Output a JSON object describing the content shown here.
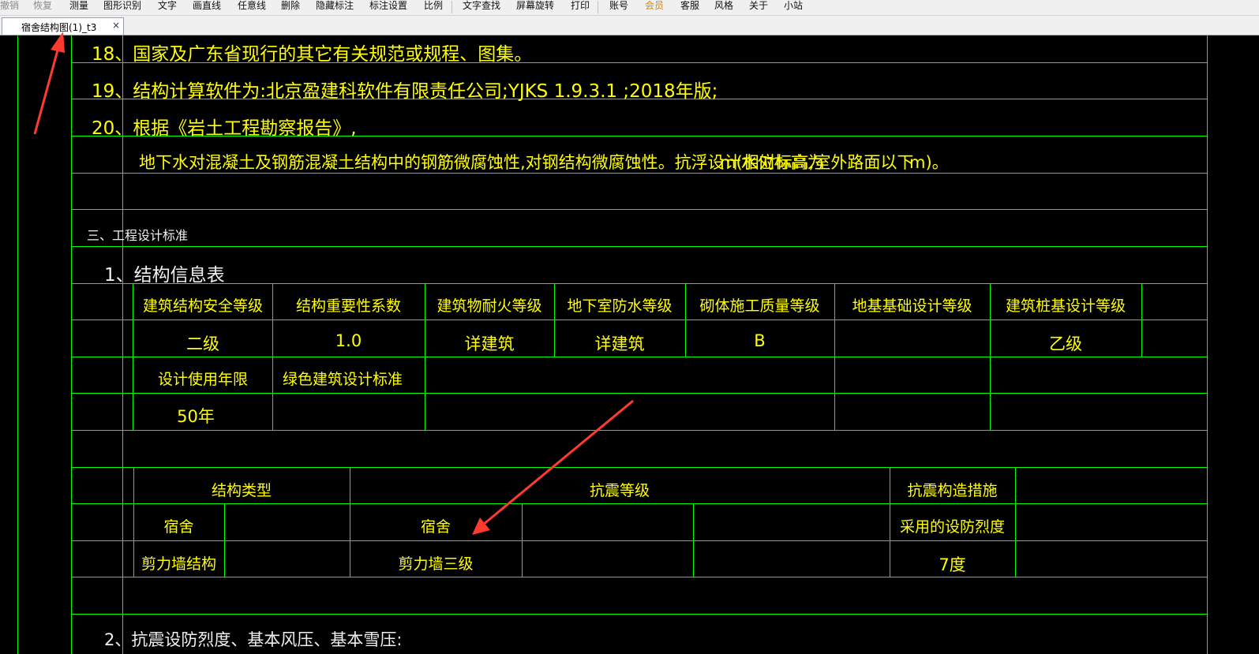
{
  "menu": [
    {
      "label": "撤销",
      "state": "disabled"
    },
    {
      "label": "恢复",
      "state": "disabled"
    },
    {
      "label": "测量",
      "state": "normal"
    },
    {
      "label": "图形识别",
      "state": "normal"
    },
    {
      "label": "文字",
      "state": "normal"
    },
    {
      "label": "画直线",
      "state": "normal"
    },
    {
      "label": "任意线",
      "state": "normal"
    },
    {
      "label": "删除",
      "state": "normal"
    },
    {
      "label": "隐藏标注",
      "state": "normal"
    },
    {
      "label": "标注设置",
      "state": "normal"
    },
    {
      "label": "比例",
      "state": "normal"
    },
    {
      "label": "文字查找",
      "state": "normal"
    },
    {
      "label": "屏幕旋转",
      "state": "normal"
    },
    {
      "label": "打印",
      "state": "normal"
    },
    {
      "label": "账号",
      "state": "normal"
    },
    {
      "label": "会员",
      "state": "vip"
    },
    {
      "label": "客服",
      "state": "normal"
    },
    {
      "label": "风格",
      "state": "normal"
    },
    {
      "label": "关于",
      "state": "normal"
    },
    {
      "label": "小站",
      "state": "normal"
    }
  ],
  "tab": {
    "label": "宿舍结构图(1)_t3",
    "close": "×"
  },
  "colors": {
    "cad_text": "#ffff00",
    "cad_lines": "#00ff00",
    "cad_heading": "#f0f0f0",
    "background": "#000000",
    "annotation_arrow": "#ff3b30",
    "vip_menu": "#d08a00"
  },
  "notes": {
    "n18": "18、国家及广东省现行的其它有关规范或规程、图集。",
    "n19": "19、结构计算软件为:北京盈建科软件有限责任公司;YJKS 1.9.3.1 ;2018年版;",
    "n20": "20、根据《岩土工程勘察报告》,",
    "n20_detail_a": "地下水对混凝土及钢筋混凝土结构中的钢筋微腐蚀性,对钢结构微腐蚀性。抗浮设计水位标高为",
    "n20_detail_b": "m(相对标高,室外路面以下",
    "n20_detail_c": "m)。"
  },
  "section3": {
    "title": "三、工程设计标准"
  },
  "table1": {
    "title": "1、结构信息表",
    "header": [
      "建筑结构安全等级",
      "结构重要性系数",
      "建筑物耐火等级",
      "地下室防水等级",
      "砌体施工质量等级",
      "地基基础设计等级",
      "建筑桩基设计等级"
    ],
    "values": [
      "二级",
      "1.0",
      "详建筑",
      "详建筑",
      "B",
      "",
      "乙级"
    ],
    "service_life_label": "设计使用年限",
    "green_standard_label": "绿色建筑设计标准",
    "service_life_value": "50年"
  },
  "table2": {
    "col_structure_type": "结构类型",
    "col_seismic_grade": "抗震等级",
    "col_seismic_measure": "抗震构造措施",
    "row_building_a": "宿舍",
    "row_building_b": "宿舍",
    "fortification_label": "采用的设防烈度",
    "structure_value": "剪力墙结构",
    "grade_value": "剪力墙三级",
    "intensity_value": "7度"
  },
  "section_next": {
    "title": "2、抗震设防烈度、基本风压、基本雪压:"
  }
}
